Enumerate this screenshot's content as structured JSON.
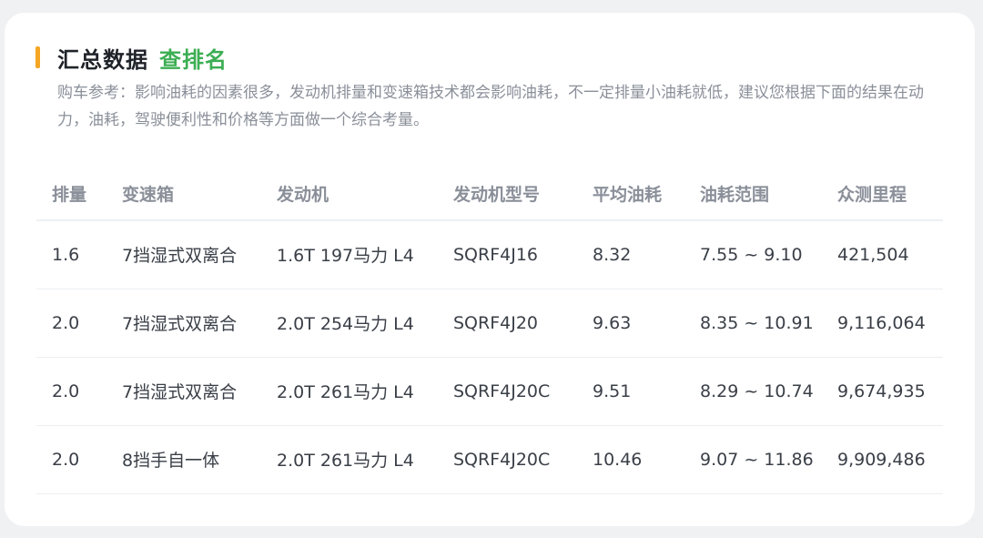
{
  "header": {
    "title": "汇总数据",
    "link_label": "查排名",
    "accent_color": "#f5a623",
    "link_color": "#3cae53"
  },
  "description": "购车参考：影响油耗的因素很多，发动机排量和变速箱技术都会影响油耗，不一定排量小油耗就低，建议您根据下面的结果在动力，油耗，驾驶便利性和价格等方面做一个综合考量。",
  "table": {
    "columns": [
      "排量",
      "变速箱",
      "发动机",
      "发动机型号",
      "平均油耗",
      "油耗范围",
      "众测里程"
    ],
    "rows": [
      [
        "1.6",
        "7挡湿式双离合",
        "1.6T 197马力 L4",
        "SQRF4J16",
        "8.32",
        "7.55 ~ 9.10",
        "421,504"
      ],
      [
        "2.0",
        "7挡湿式双离合",
        "2.0T 254马力 L4",
        "SQRF4J20",
        "9.63",
        "8.35 ~ 10.91",
        "9,116,064"
      ],
      [
        "2.0",
        "7挡湿式双离合",
        "2.0T 261马力 L4",
        "SQRF4J20C",
        "9.51",
        "8.29 ~ 10.74",
        "9,674,935"
      ],
      [
        "2.0",
        "8挡手自一体",
        "2.0T 261马力 L4",
        "SQRF4J20C",
        "10.46",
        "9.07 ~ 11.86",
        "9,909,486"
      ]
    ]
  }
}
